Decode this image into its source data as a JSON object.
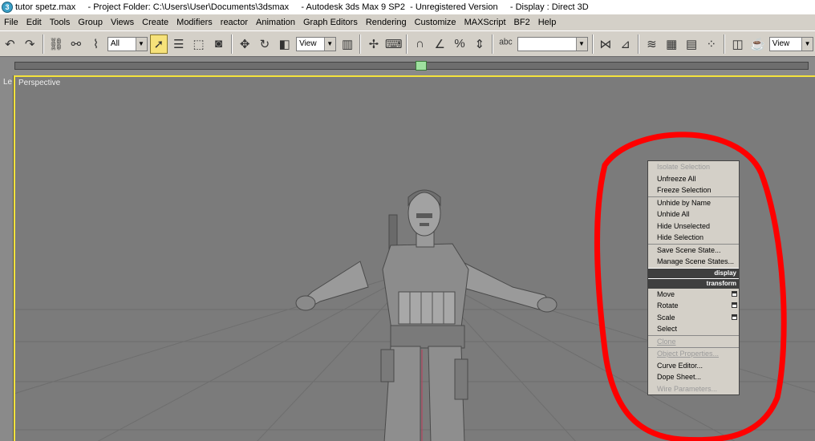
{
  "title": {
    "text": "tutor spetz.max     - Project Folder: C:\\Users\\User\\Documents\\3dsmax     - Autodesk 3ds Max 9 SP2  - Unregistered Version     - Display : Direct 3D"
  },
  "menu": [
    "File",
    "Edit",
    "Tools",
    "Group",
    "Views",
    "Create",
    "Modifiers",
    "reactor",
    "Animation",
    "Graph Editors",
    "Rendering",
    "Customize",
    "MAXScript",
    "BF2",
    "Help"
  ],
  "toolbar": {
    "selection_filter": "All",
    "ref_coord": "View",
    "named_selection": "",
    "render_view": "View"
  },
  "viewport": {
    "left_label": "Le",
    "label": "Perspective"
  },
  "quad_menu": {
    "display_header": "display",
    "transform_header": "transform",
    "display_items": [
      {
        "label": "Isolate Selection",
        "enabled": false
      },
      {
        "label": "Unfreeze All",
        "enabled": true
      },
      {
        "label": "Freeze Selection",
        "enabled": true
      },
      {
        "label": "Unhide by Name",
        "enabled": true
      },
      {
        "label": "Unhide All",
        "enabled": true
      },
      {
        "label": "Hide Unselected",
        "enabled": true
      },
      {
        "label": "Hide Selection",
        "enabled": true
      },
      {
        "label": "Save Scene State...",
        "enabled": true
      },
      {
        "label": "Manage Scene States...",
        "enabled": true
      }
    ],
    "transform_items": [
      {
        "label": "Move",
        "enabled": true
      },
      {
        "label": "Rotate",
        "enabled": true
      },
      {
        "label": "Scale",
        "enabled": true
      },
      {
        "label": "Select",
        "enabled": true
      },
      {
        "label": "Clone",
        "enabled": false
      },
      {
        "label": "Object Properties...",
        "enabled": false
      },
      {
        "label": "Curve Editor...",
        "enabled": true
      },
      {
        "label": "Dope Sheet...",
        "enabled": true
      },
      {
        "label": "Wire Parameters...",
        "enabled": false
      }
    ]
  },
  "annotation_color": "#ff0000",
  "viewport_border_color": "#f4e23c"
}
